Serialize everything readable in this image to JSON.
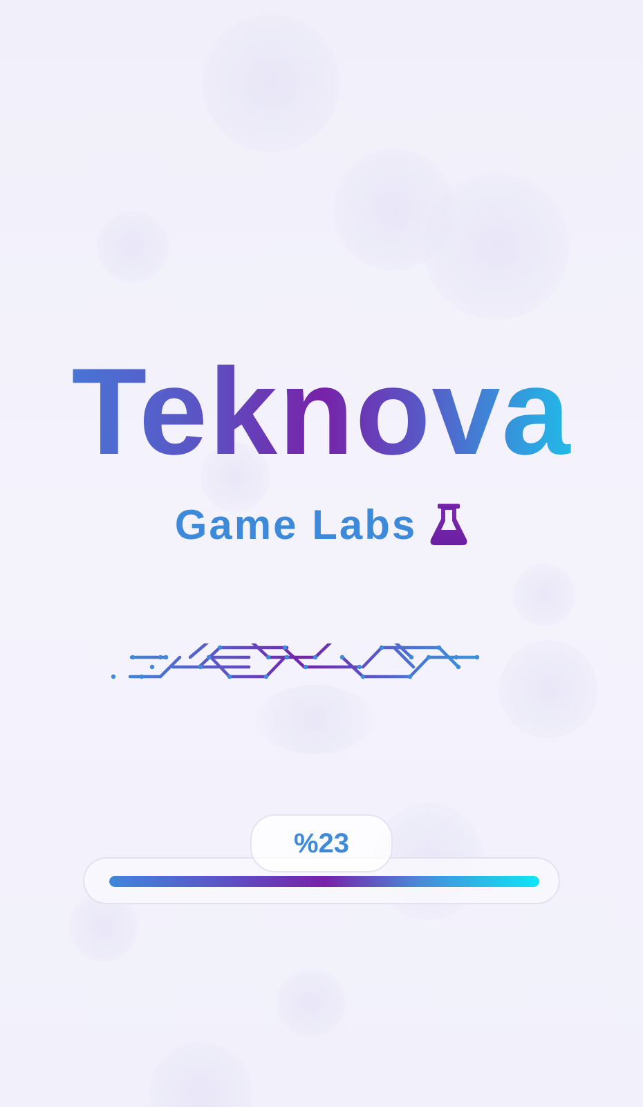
{
  "splash": {
    "title": "Teknova",
    "subtitle": "Game Labs",
    "subtitle_icon": "flask-icon"
  },
  "loading": {
    "progress": 1.0,
    "label": "%23"
  },
  "colors": {
    "background": "#f3f2fb",
    "gradient_blue": "#3f87dd",
    "gradient_purple": "#7722a8",
    "gradient_cyan": "#0ce6f8",
    "subtitle": "#3d8adb"
  }
}
